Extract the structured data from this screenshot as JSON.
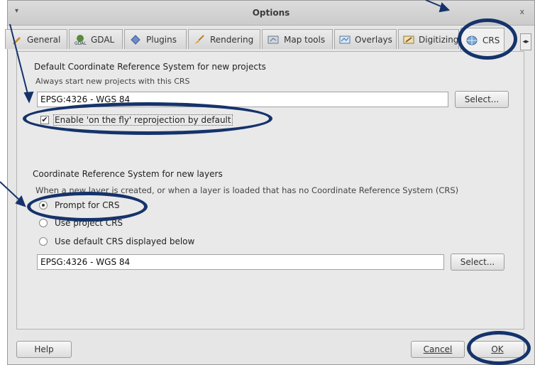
{
  "window": {
    "title": "Options",
    "menu_glyph": "▾",
    "close_glyph": "x"
  },
  "tabs": [
    {
      "label": "General",
      "icon": "wrench-icon"
    },
    {
      "label": "GDAL",
      "icon": "gdal-icon"
    },
    {
      "label": "Plugins",
      "icon": "plugin-icon"
    },
    {
      "label": "Rendering",
      "icon": "brush-icon"
    },
    {
      "label": "Map tools",
      "icon": "map-tools-icon"
    },
    {
      "label": "Overlays",
      "icon": "overlays-icon"
    },
    {
      "label": "Digitizing",
      "icon": "digitizing-icon"
    },
    {
      "label": "CRS",
      "icon": "globe-icon",
      "active": true
    }
  ],
  "tab_scroll_glyph": "◂▸",
  "project_crs": {
    "title": "Default Coordinate Reference System for new projects",
    "hint": "Always start new projects with this CRS",
    "value": "EPSG:4326 - WGS 84",
    "select_label": "Select...",
    "otf_label": "Enable 'on the fly' reprojection by default",
    "otf_checked": true
  },
  "layer_crs": {
    "title": "Coordinate Reference System for new layers",
    "hint": "When a new layer is created, or when a layer is loaded that has no Coordinate Reference System (CRS)",
    "options": [
      {
        "label": "Prompt for CRS",
        "selected": true
      },
      {
        "label": "Use project CRS",
        "selected": false
      },
      {
        "label": "Use default CRS displayed below",
        "selected": false
      }
    ],
    "value": "EPSG:4326 - WGS 84",
    "select_label": "Select..."
  },
  "footer": {
    "help": "Help",
    "cancel": "Cancel",
    "ok": "OK"
  },
  "annotation_color": "#15336b"
}
